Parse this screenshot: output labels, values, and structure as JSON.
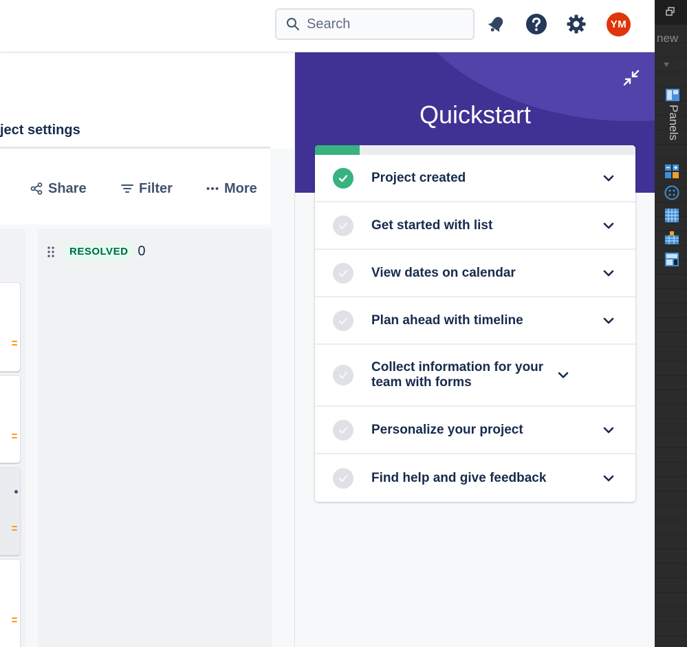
{
  "topbar": {
    "search_placeholder": "Search",
    "avatar_initials": "YM",
    "icons": [
      "search-icon",
      "notifications-icon",
      "help-icon",
      "settings-icon"
    ]
  },
  "board": {
    "tab_label": "ject settings",
    "toolbar": {
      "share_label": "Share",
      "filter_label": "Filter",
      "more_label": "More"
    },
    "column": {
      "status": "RESOLVED",
      "count": "0"
    }
  },
  "quickstart": {
    "title": "Quickstart",
    "progress_percent": 14,
    "items": [
      {
        "label": "Project created",
        "done": true
      },
      {
        "label": "Get started with list",
        "done": false
      },
      {
        "label": "View dates on calendar",
        "done": false
      },
      {
        "label": "Plan ahead with timeline",
        "done": false
      },
      {
        "label": "Collect information for your team with forms",
        "done": false
      },
      {
        "label": "Personalize your project",
        "done": false
      },
      {
        "label": "Find help and give feedback",
        "done": false
      }
    ]
  },
  "dock": {
    "new_label": "new",
    "panels_label": "Panels"
  },
  "colors": {
    "quickstart_header": "#403294",
    "done_green": "#36b37e",
    "avatar_red": "#de350b",
    "resolved_text": "#006644",
    "resolved_bg": "#e3fcef"
  }
}
